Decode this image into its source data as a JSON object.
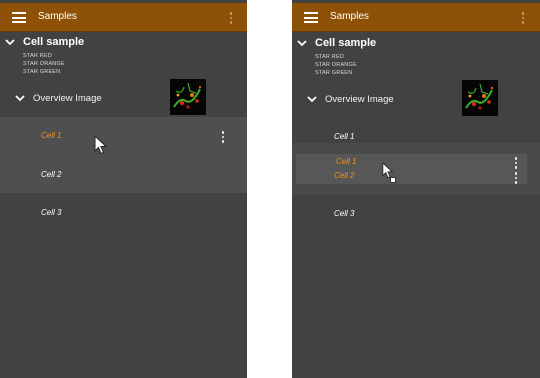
{
  "panels": [
    {
      "app_title": "Samples",
      "sample_title": "Cell sample",
      "channels": [
        "STAR RED",
        "STAR ORANGE",
        "STAR GREEN"
      ],
      "group_label": "Overview Image",
      "cells": [
        "Cell 1",
        "Cell 2",
        "Cell 3"
      ],
      "active_cell": "Cell 1"
    },
    {
      "app_title": "Samples",
      "sample_title": "Cell sample",
      "channels": [
        "STAR RED",
        "STAR ORANGE",
        "STAR GREEN"
      ],
      "group_label": "Overview Image",
      "cells": [
        "Cell 1",
        "Cell 2",
        "Cell 3"
      ],
      "drag_items": [
        "Cell 1",
        "Cell 2"
      ]
    }
  ],
  "icons": {
    "menu": "menu-icon",
    "overflow": "more-vert-icon",
    "expand": "chevron-down-icon",
    "pointer": "mouse-pointer-icon"
  },
  "colors": {
    "appbar": "#8d5208",
    "background": "#424242",
    "highlight": "#4f4f4f",
    "active_text": "#f0941e"
  }
}
